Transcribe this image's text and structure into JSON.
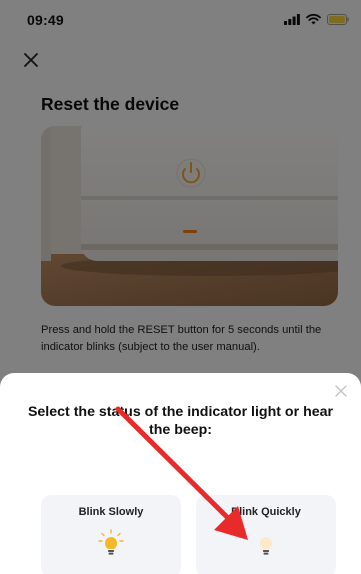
{
  "status_bar": {
    "time": "09:49",
    "icons": [
      "signal-icon",
      "wifi-icon",
      "battery-icon"
    ]
  },
  "header": {
    "close_icon": "close-icon"
  },
  "main": {
    "title": "Reset the device",
    "image_subject": "device-with-power-button",
    "description": "Press and hold the RESET button for 5 seconds until the indicator blinks (subject to the user manual)."
  },
  "sheet": {
    "close_icon": "close-icon",
    "title": "Select the status of the indicator light or hear the beep:",
    "options": [
      {
        "label": "Blink Slowly",
        "icon": "bulb-on-icon"
      },
      {
        "label": "Blink Quickly",
        "icon": "bulb-dim-icon"
      }
    ]
  },
  "colors": {
    "accent": "#e82a2a",
    "bulb_glow": "#f5b82a",
    "battery": "#f3d23a",
    "overlay": "rgba(0,0,0,0.48)"
  }
}
